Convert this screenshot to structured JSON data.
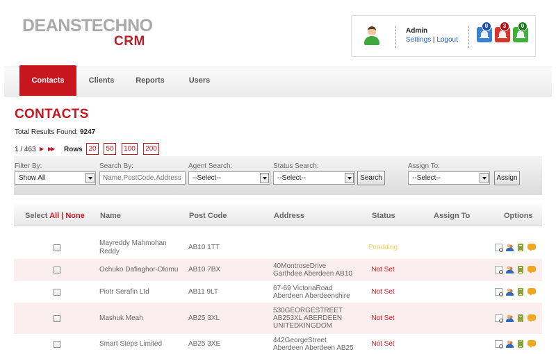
{
  "logo": {
    "line1": "DEANSTECHNO",
    "line2": "CRM"
  },
  "user": {
    "name": "Admin",
    "settings": "Settings",
    "separator": "|",
    "logout": "Logout"
  },
  "notifications": [
    {
      "icon": "bell-icon",
      "count": "0",
      "color": "#3a7fd0",
      "badge_color": "#1f4fa8"
    },
    {
      "icon": "bell-icon",
      "count": "3",
      "color": "#d9342a",
      "badge_color": "#a8161e"
    },
    {
      "icon": "bell-icon",
      "count": "0",
      "color": "#3fae3c",
      "badge_color": "#1e7a1e"
    }
  ],
  "nav": {
    "tabs": [
      "Contacts",
      "Clients",
      "Reports",
      "Users"
    ],
    "active": "Contacts"
  },
  "page": {
    "title": "CONTACTS",
    "total_label": "Total Results Found:",
    "total_count": "9247"
  },
  "pager": {
    "page_text": "1 / 463",
    "rows_label": "Rows",
    "row_options": [
      "20",
      "50",
      "100",
      "200"
    ]
  },
  "filters": {
    "filter_by": {
      "label": "Filter By:",
      "value": "Show All"
    },
    "search_by": {
      "label": "Search By:",
      "placeholder": "Name,PostCode,Address"
    },
    "agent_search": {
      "label": "Agent Search:",
      "value": "--Select--"
    },
    "status_search": {
      "label": "Status Search:",
      "value": "--Select--"
    },
    "search_button": "Search",
    "assign_to": {
      "label": "Assign To:",
      "value": "--Select--"
    },
    "assign_button": "Assign"
  },
  "table": {
    "headers": {
      "select": "Select",
      "all": "All",
      "separator": "|",
      "none": "None",
      "name": "Name",
      "postcode": "Post Code",
      "address": "Address",
      "status": "Status",
      "assign_to": "Assign To",
      "options": "Options"
    },
    "rows": [
      {
        "name": [
          "Mayreddy Mahmohan",
          "Reddy"
        ],
        "postcode": "AB10 1TT",
        "address": [],
        "status": "Pendding"
      },
      {
        "name": [
          "Ochuko Dafiaghor-Olomu"
        ],
        "postcode": "AB10 7BX",
        "address": [
          "40MontroseDrive",
          "Garthdee Aberdeen AB10"
        ],
        "status": "Not Set"
      },
      {
        "name": [
          "Piotr Serafin Ltd"
        ],
        "postcode": "AB11 9LT",
        "address": [
          "67-69 VictoriaRoad",
          "Aberdeen Aberdeenshire"
        ],
        "status": "Not Set"
      },
      {
        "name": [
          "Mashuk Meah"
        ],
        "postcode": "AB25 3XL",
        "address": [
          "530GEORGESTREET",
          "AB253XL ABERDEEN",
          "UNITEDKINGDOM"
        ],
        "status": "Not Set"
      },
      {
        "name": [
          "Smart Steps Limited"
        ],
        "postcode": "AB25 3XE",
        "address": [
          "442GeorgeStreet",
          "Aberdeen Aberdeen AB25"
        ],
        "status": "Not Set"
      }
    ]
  },
  "colors": {
    "brand_red": "#c8161e",
    "pending": "#f2cd58",
    "link_blue": "#2a66b8"
  }
}
